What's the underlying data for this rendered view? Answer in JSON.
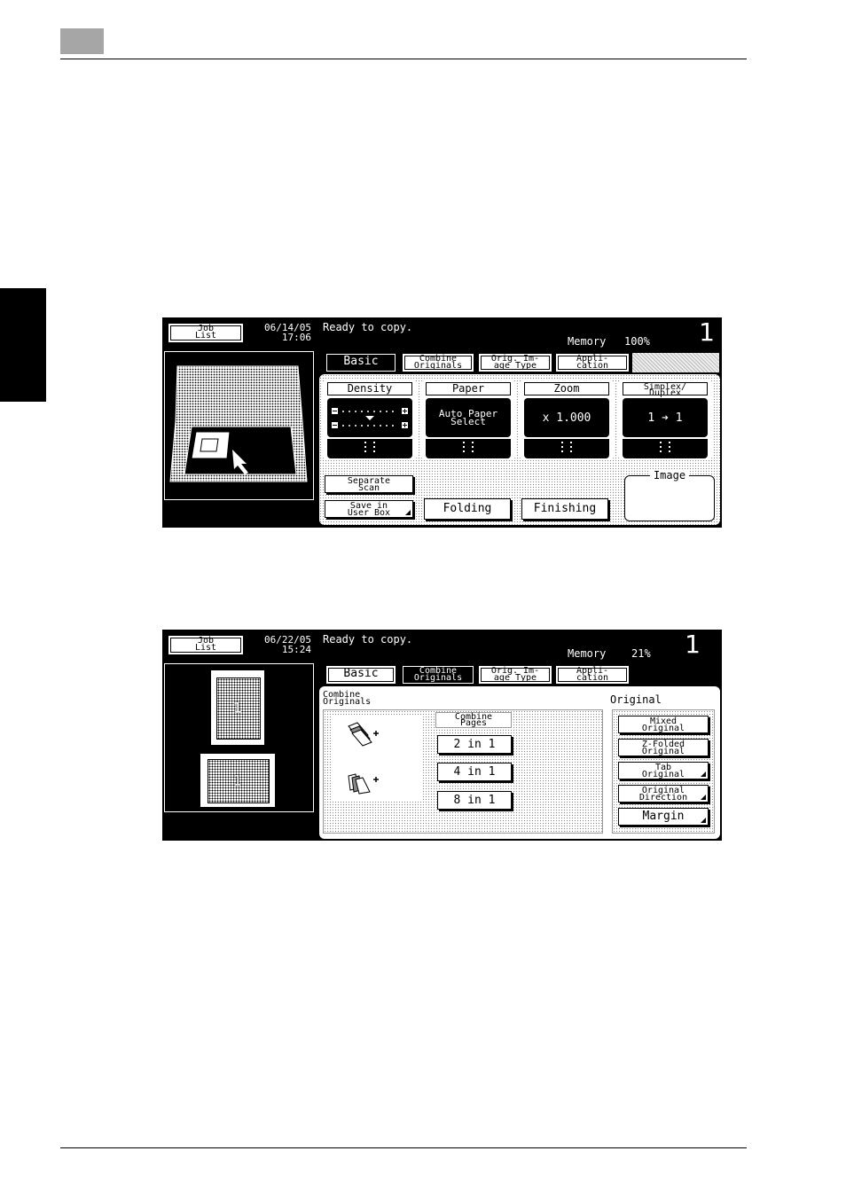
{
  "screen1": {
    "job_list": "Job\nList",
    "date": "06/14/05",
    "time": "17:06",
    "status": "Ready to copy.",
    "memory_label": "Memory",
    "memory_value": "100%",
    "copies": "1",
    "tabs": [
      "Basic",
      "Combine\nOriginals",
      "Orig. Im-\nage Type",
      "Appli-\ncation"
    ],
    "active_tab": "Basic",
    "density_label": "Density",
    "paper_label": "Paper",
    "paper_value": "Auto Paper\nSelect",
    "zoom_label": "Zoom",
    "zoom_value": "x 1.000",
    "duplex_label": "Simplex/\nDuplex",
    "duplex_value": "1 ➔ 1",
    "separate_scan": "Separate\nScan",
    "save_user_box": "Save in\nUser Box",
    "folding": "Folding",
    "finishing": "Finishing",
    "image_label": "Image"
  },
  "screen2": {
    "job_list": "Job\nList",
    "date": "06/22/05",
    "time": "15:24",
    "status": "Ready to copy.",
    "memory_label": "Memory",
    "memory_value": "21%",
    "copies": "1",
    "tabs": [
      "Basic",
      "Combine\nOriginals",
      "Orig. Im-\nage Type",
      "Appli-\ncation"
    ],
    "active_tab": "Combine\nOriginals",
    "combine_originals_heading": "Combine\nOriginals",
    "combine_pages_heading": "Combine\nPages",
    "options": [
      "2 in 1",
      "4 in 1",
      "8 in 1"
    ],
    "original_heading": "Original",
    "original_buttons": [
      "Mixed\nOriginal",
      "Z-Folded\nOriginal",
      "Tab\nOriginal",
      "Original\nDirection",
      "Margin"
    ],
    "preview_page": "1"
  }
}
